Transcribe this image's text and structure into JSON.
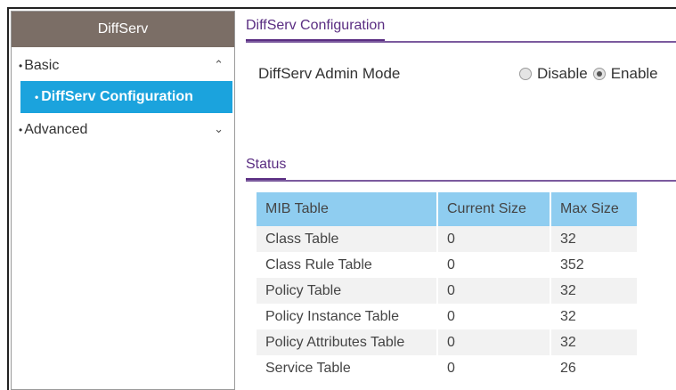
{
  "sidebar": {
    "header": "DiffServ",
    "basic": {
      "label": "Basic",
      "chevron": "chevron-up-icon"
    },
    "basic_sub": {
      "label": "DiffServ Configuration"
    },
    "advanced": {
      "label": "Advanced",
      "chevron": "chevron-down-icon"
    }
  },
  "config": {
    "title": "DiffServ Configuration",
    "admin_mode_label": "DiffServ Admin Mode",
    "options": [
      {
        "label": "Disable",
        "checked": false
      },
      {
        "label": "Enable",
        "checked": true
      }
    ]
  },
  "status": {
    "title": "Status",
    "table": {
      "headers": [
        "MIB Table",
        "Current Size",
        "Max Size"
      ],
      "rows": [
        [
          "Class Table",
          "0",
          "32"
        ],
        [
          "Class Rule Table",
          "0",
          "352"
        ],
        [
          "Policy Table",
          "0",
          "32"
        ],
        [
          "Policy Instance Table",
          "0",
          "32"
        ],
        [
          "Policy Attributes Table",
          "0",
          "32"
        ],
        [
          "Service Table",
          "0",
          "26"
        ]
      ]
    }
  },
  "colors": {
    "sidebar_header_bg": "#7b6e66",
    "active_nav_bg": "#1ba3dd",
    "section_title": "#5a2d82",
    "table_header_bg": "#8fcdf0"
  }
}
